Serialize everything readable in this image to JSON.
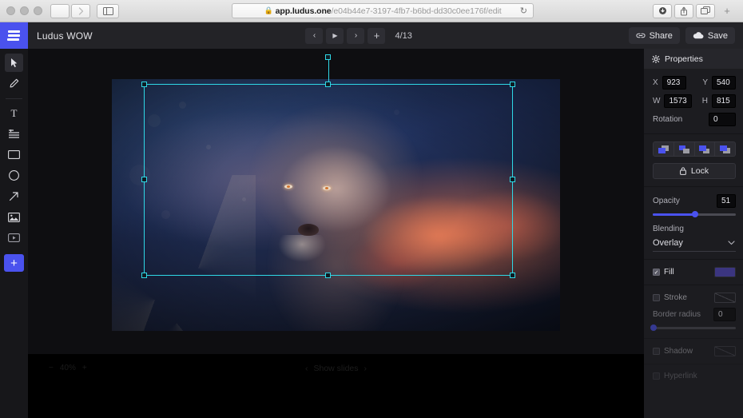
{
  "browser": {
    "url_host": "app.ludus.one",
    "url_path": "/e04b44e7-3197-4fb7-b6bd-dd30c0ee176f/edit",
    "back_icon": "chevron-left-icon",
    "forward_icon": "chevron-right-icon",
    "sidebar_icon": "sidebar-toggle-icon",
    "lock_icon": "🔒",
    "reload_icon": "↻",
    "downloads_icon": "⬇",
    "share_icon": "⬆",
    "tabs_icon": "⧉",
    "newtab_icon": "+"
  },
  "appbar": {
    "menu_icon": "hamburger-icon",
    "title": "Ludus WOW",
    "prev_label": "‹",
    "play_label": "▶",
    "next_label": "›",
    "add_label": "+",
    "counter": "4/13",
    "share_label": "Share",
    "save_label": "Save"
  },
  "tools": [
    {
      "name": "select-tool",
      "glyph": "➤",
      "active": true
    },
    {
      "name": "pen-tool",
      "glyph": "✏",
      "active": false
    },
    {
      "name": "text-tool",
      "glyph": "T",
      "active": false
    },
    {
      "name": "list-tool",
      "glyph": "≡",
      "active": false
    },
    {
      "name": "rectangle-tool",
      "glyph": "▭",
      "active": false
    },
    {
      "name": "ellipse-tool",
      "glyph": "◯",
      "active": false
    },
    {
      "name": "arrow-tool",
      "glyph": "↗",
      "active": false
    },
    {
      "name": "image-tool",
      "glyph": "🖼",
      "active": false
    },
    {
      "name": "video-tool",
      "glyph": "▷",
      "active": false
    },
    {
      "name": "add-tool",
      "glyph": "+",
      "active": false
    }
  ],
  "canvas": {
    "zoom_level": "40%",
    "zoom_out_label": "−",
    "zoom_in_label": "+",
    "show_slides_label": "Show slides",
    "show_slides_left": "‹",
    "show_slides_right": "›"
  },
  "properties": {
    "header": "Properties",
    "header_icon": "gear-icon",
    "x_label": "X",
    "x_value": "923",
    "y_label": "Y",
    "y_value": "540",
    "w_label": "W",
    "w_value": "1573",
    "h_label": "H",
    "h_value": "815",
    "rotation_label": "Rotation",
    "rotation_value": "0",
    "layer_buttons": [
      "send-to-back-button",
      "send-backward-button",
      "bring-forward-button",
      "bring-to-front-button"
    ],
    "lock_label": "Lock",
    "lock_icon": "padlock-icon",
    "opacity_label": "Opacity",
    "opacity_value": "51",
    "blending_label": "Blending",
    "blending_value": "Overlay",
    "fill_label": "Fill",
    "fill_checked": true,
    "fill_color": "#3b3580",
    "stroke_label": "Stroke",
    "stroke_checked": false,
    "border_radius_label": "Border radius",
    "border_radius_value": "0",
    "shadow_label": "Shadow",
    "shadow_checked": false,
    "hyperlink_label": "Hyperlink",
    "hyperlink_checked": false
  },
  "colors": {
    "accent_blue": "#4a52ee",
    "selection_cyan": "#2fd8e6",
    "panel_bg": "#1c1c20",
    "appbar_bg": "#232327"
  }
}
